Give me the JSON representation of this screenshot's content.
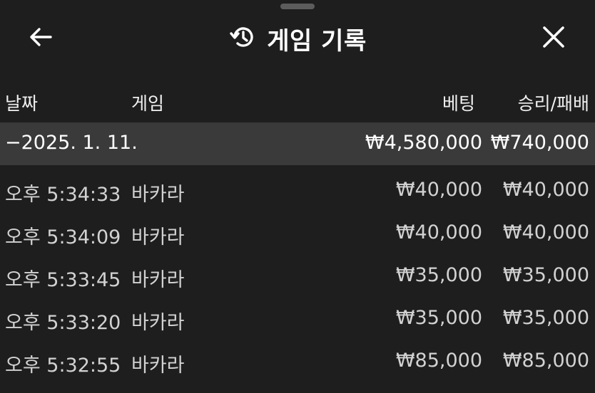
{
  "header": {
    "title": "게임 기록",
    "back_icon": "arrow-left-icon",
    "history_icon": "history-icon",
    "close_icon": "close-icon"
  },
  "columns": {
    "date": "날짜",
    "game": "게임",
    "bet": "베팅",
    "result": "승리/패배"
  },
  "group": {
    "date": "−2025. 1. 11.",
    "bet_total": "₩4,580,000",
    "result_total": "₩740,000"
  },
  "rows": [
    {
      "time": "오후 5:34:33",
      "game": "바카라",
      "bet": "₩40,000",
      "result": "₩40,000"
    },
    {
      "time": "오후 5:34:09",
      "game": "바카라",
      "bet": "₩40,000",
      "result": "₩40,000"
    },
    {
      "time": "오후 5:33:45",
      "game": "바카라",
      "bet": "₩35,000",
      "result": "₩35,000"
    },
    {
      "time": "오후 5:33:20",
      "game": "바카라",
      "bet": "₩35,000",
      "result": "₩35,000"
    },
    {
      "time": "오후 5:32:55",
      "game": "바카라",
      "bet": "₩85,000",
      "result": "₩85,000"
    }
  ]
}
